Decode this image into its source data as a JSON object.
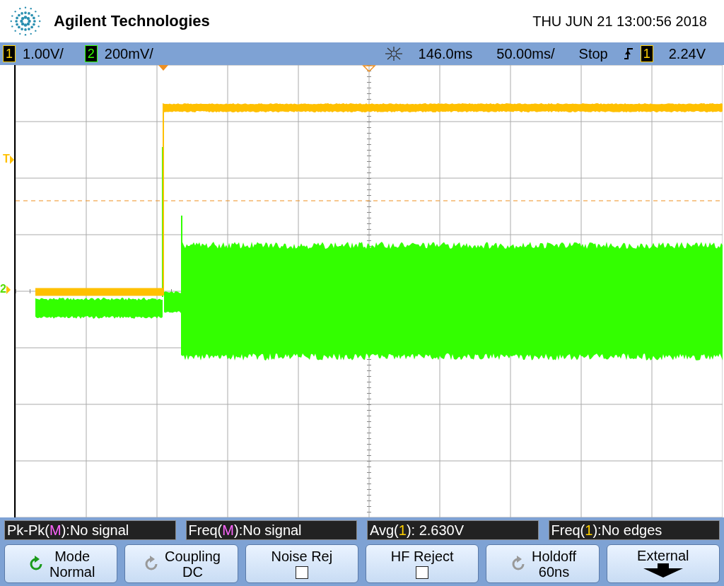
{
  "header": {
    "brand": "Agilent Technologies",
    "datetime": "THU JUN 21 13:00:56 2018"
  },
  "status_bar": {
    "channels": [
      {
        "number": "1",
        "scale": "1.00V/",
        "color": "#ffd000"
      },
      {
        "number": "2",
        "scale": "200mV/",
        "color": "#33ff00"
      }
    ],
    "delay": "146.0ms",
    "timebase": "50.00ms/",
    "run_state": "Stop",
    "trigger": {
      "source": "1",
      "color": "#ffd000",
      "level": "2.24V"
    }
  },
  "screen": {
    "trigger_marker": "T",
    "ground_marker": "2"
  },
  "measurements": [
    {
      "prefix": "Pk-Pk(",
      "source": "M",
      "rest": "):No signal",
      "color": "#ff66ff"
    },
    {
      "prefix": "Freq(",
      "source": "M",
      "rest": "):No signal",
      "color": "#ff66ff"
    },
    {
      "prefix": "Avg(",
      "source": "1",
      "rest": "): 2.630V",
      "color": "#ffd000"
    },
    {
      "prefix": "Freq(",
      "source": "1",
      "rest": "):No edges",
      "color": "#ffd000"
    }
  ],
  "softkeys": [
    {
      "kind": "cycle",
      "label": "Mode",
      "value": "Normal",
      "active": true
    },
    {
      "kind": "cycle",
      "label": "Coupling",
      "value": "DC",
      "active": false
    },
    {
      "kind": "toggle",
      "label": "Noise Rej",
      "checked": false
    },
    {
      "kind": "toggle",
      "label": "HF Reject",
      "checked": false
    },
    {
      "kind": "cycle",
      "label": "Holdoff",
      "value": "60ns",
      "active": false
    },
    {
      "kind": "menu",
      "label": "External"
    }
  ]
}
